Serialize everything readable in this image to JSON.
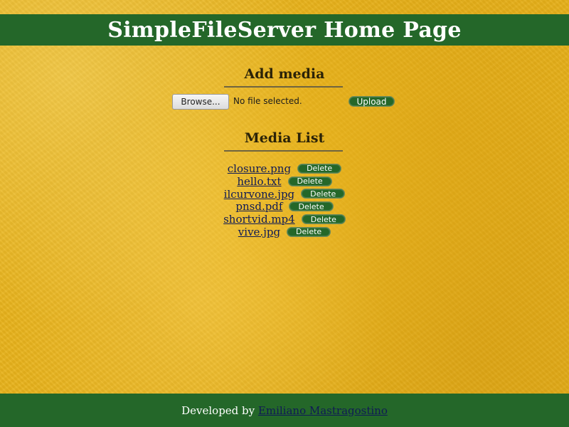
{
  "header": {
    "title": "SimpleFileServer Home Page"
  },
  "add_media": {
    "title": "Add media",
    "browse_label": "Browse...",
    "file_status": "No file selected.",
    "upload_label": "Upload"
  },
  "media_list": {
    "title": "Media List",
    "delete_label": "Delete",
    "items": [
      {
        "name": "closure.png"
      },
      {
        "name": "hello.txt"
      },
      {
        "name": "ilcurvone.jpg"
      },
      {
        "name": "pnsd.pdf"
      },
      {
        "name": "shortvid.mp4"
      },
      {
        "name": "vive.jpg"
      }
    ]
  },
  "footer": {
    "prefix": "Developed by",
    "author": "Emiliano Mastragostino"
  },
  "colors": {
    "green": "#246729",
    "background": "#e7b21c",
    "link": "#0f1a55"
  }
}
